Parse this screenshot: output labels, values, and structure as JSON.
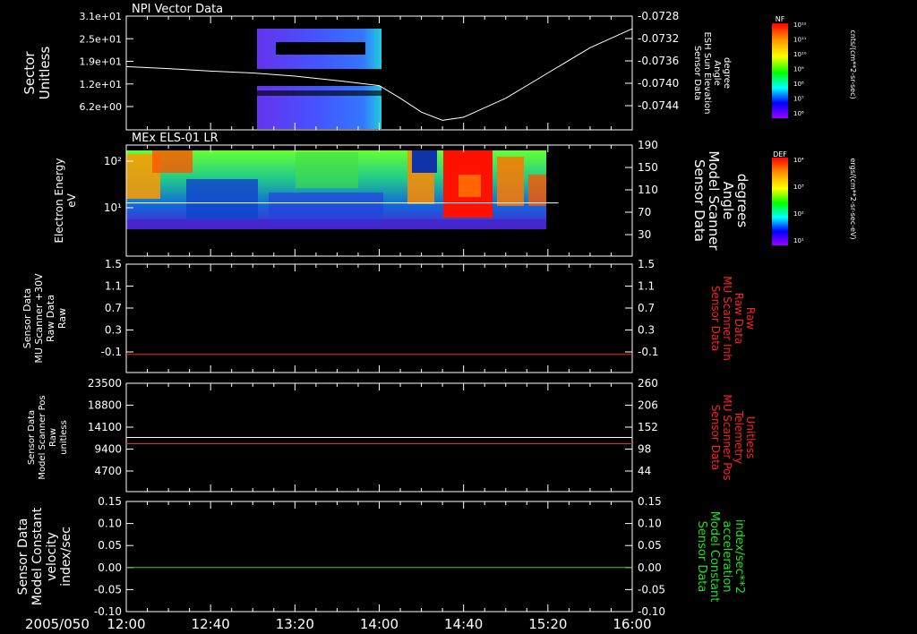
{
  "colors": {
    "background": "#000000",
    "axis": "#ffffff",
    "trace_white": "#ffffff",
    "trace_red": "#ff2020",
    "trace_green": "#20e020"
  },
  "time_axis": {
    "date_label": "2005/050",
    "ticks": [
      "12:00",
      "12:40",
      "13:20",
      "14:00",
      "14:40",
      "15:20",
      "16:00"
    ]
  },
  "chart_data": [
    {
      "type": "heatmap",
      "panel": "npi",
      "title": "NPI Vector Data",
      "ylabel_left": [
        "Sector",
        "Unitless"
      ],
      "left_ticks": [
        "3.1e+01",
        "2.5e+01",
        "1.9e+01",
        "1.2e+01",
        "6.2e+00"
      ],
      "ylabel_right": [
        "Sensor Data",
        "ESH Sun Elevation",
        "Angle",
        "degree"
      ],
      "right_ticks": [
        "-0.0728",
        "-0.0732",
        "-0.0736",
        "-0.0740",
        "-0.0744"
      ],
      "right_ylim": [
        -0.0746,
        -0.0728
      ],
      "heat_block_time": [
        "13:00",
        "14:00"
      ],
      "line_series": {
        "color": "#ffffff",
        "x": [
          "12:00",
          "12:20",
          "12:40",
          "13:00",
          "13:20",
          "13:40",
          "14:00",
          "14:10",
          "14:20",
          "14:30",
          "14:40",
          "14:50",
          "15:00",
          "15:20",
          "15:40",
          "16:00"
        ],
        "y": [
          -0.0736,
          -0.07363,
          -0.07367,
          -0.0737,
          -0.07375,
          -0.07382,
          -0.0739,
          -0.0741,
          -0.07432,
          -0.07445,
          -0.0744,
          -0.07425,
          -0.0741,
          -0.0737,
          -0.0733,
          -0.073
        ]
      },
      "colorbar": {
        "label": "NF",
        "unit": "cnts/(cm**2-sr-sec)",
        "ticks": [
          "10¹²",
          "10¹¹",
          "10¹⁰",
          "10⁹",
          "10⁸",
          "10⁷",
          "10⁶"
        ]
      }
    },
    {
      "type": "heatmap",
      "panel": "els",
      "title": "MEx ELS-01 LR",
      "ylabel_left": [
        "Electron Energy",
        "eV"
      ],
      "left_ticks": [
        "10²",
        "10¹"
      ],
      "ylabel_right": [
        "Sensor Data",
        "Model Scanner",
        "Angle",
        "degrees"
      ],
      "right_ticks": [
        "190",
        "150",
        "110",
        "70",
        "30"
      ],
      "right_ylim": [
        0,
        190
      ],
      "heat_block_time": [
        "12:00",
        "15:25"
      ],
      "line_series": {
        "color": "#ffffff",
        "x": [
          "12:00",
          "15:25"
        ],
        "y": [
          91,
          91
        ]
      },
      "colorbar": {
        "label": "DEF",
        "unit": "ergs/(cm**2-sr-sec-eV)",
        "ticks": [
          "10⁴",
          "10³",
          "10²",
          "10¹"
        ]
      }
    },
    {
      "type": "line",
      "panel": "mu30",
      "ylabel_left": [
        "Sensor Data",
        "MU Scanner +30V",
        "Raw Data",
        "Raw"
      ],
      "left_ticks": [
        "1.5",
        "1.1",
        "0.7",
        "0.3",
        "-0.1"
      ],
      "ylim_left": [
        -0.3,
        1.5
      ],
      "ylabel_right": [
        "Sensor Data",
        "MU Scanner Inh",
        "Raw Data",
        "Raw"
      ],
      "right_ticks": [
        "1.5",
        "1.1",
        "0.7",
        "0.3",
        "-0.1"
      ],
      "series": [
        {
          "axis": "left",
          "color": "#ff2020",
          "x": [
            "12:00",
            "16:00"
          ],
          "y": [
            0.0,
            0.0
          ]
        }
      ]
    },
    {
      "type": "line",
      "panel": "scanpos",
      "ylabel_left": [
        "Sensor Data",
        "Model Scanner Pos",
        "Raw",
        "unitless"
      ],
      "left_ticks": [
        "23500",
        "18800",
        "14100",
        "9400",
        "4700"
      ],
      "ylim_left": [
        0,
        23500
      ],
      "ylabel_right": [
        "Sensor Data",
        "MU Scanner Pos",
        "Telemetry",
        "Unitless"
      ],
      "right_ticks": [
        "260",
        "206",
        "152",
        "98",
        "44"
      ],
      "ylim_right": [
        0,
        260
      ],
      "series": [
        {
          "axis": "left",
          "color": "#ffffff",
          "x": [
            "12:00",
            "16:00"
          ],
          "y": [
            11750,
            11750
          ]
        },
        {
          "axis": "right",
          "color": "#ff2020",
          "x": [
            "12:00",
            "16:00"
          ],
          "y": [
            115,
            115
          ]
        }
      ]
    },
    {
      "type": "line",
      "panel": "constant",
      "ylabel_left": [
        "Sensor Data",
        "Model Constant",
        "velocity",
        "index/sec"
      ],
      "left_ticks": [
        "0.15",
        "0.10",
        "0.05",
        "0.00",
        "-0.05",
        "-0.10"
      ],
      "ylim_left": [
        -0.1,
        0.15
      ],
      "ylabel_right": [
        "Sensor Data",
        "Model Constant",
        "acceleration",
        "index/sec**2"
      ],
      "right_ticks": [
        "0.15",
        "0.10",
        "0.05",
        "0.00",
        "-0.05",
        "-0.10"
      ],
      "series": [
        {
          "axis": "left",
          "color": "#20e020",
          "x": [
            "12:00",
            "16:00"
          ],
          "y": [
            0.0,
            0.0
          ]
        }
      ]
    }
  ]
}
